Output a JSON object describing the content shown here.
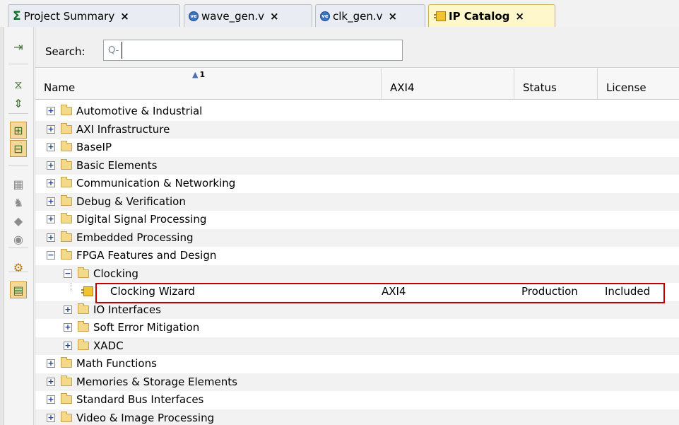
{
  "tabs": [
    {
      "label": "Project Summary",
      "icon": "sigma-icon",
      "glyph": "Σ"
    },
    {
      "label": "wave_gen.v",
      "icon": "verilog-file-icon",
      "glyph": "ve"
    },
    {
      "label": "clk_gen.v",
      "icon": "verilog-file-icon",
      "glyph": "ve"
    },
    {
      "label": "IP Catalog",
      "icon": "ip-icon",
      "active": true
    }
  ],
  "tab_close_glyph": "×",
  "search": {
    "label": "Search:",
    "value": "",
    "glyph": "Q-"
  },
  "columns": {
    "name": "Name",
    "axi4": "AXI4",
    "status": "Status",
    "license": "License",
    "sort_rank": "1",
    "sort_glyph": "▲"
  },
  "tree": [
    {
      "label": "Automotive & Industrial",
      "level": 0,
      "expander": "+"
    },
    {
      "label": "AXI Infrastructure",
      "level": 0,
      "expander": "+"
    },
    {
      "label": "BaseIP",
      "level": 0,
      "expander": "+"
    },
    {
      "label": "Basic Elements",
      "level": 0,
      "expander": "+"
    },
    {
      "label": "Communication & Networking",
      "level": 0,
      "expander": "+"
    },
    {
      "label": "Debug & Verification",
      "level": 0,
      "expander": "+"
    },
    {
      "label": "Digital Signal Processing",
      "level": 0,
      "expander": "+"
    },
    {
      "label": "Embedded Processing",
      "level": 0,
      "expander": "+"
    },
    {
      "label": "FPGA Features and Design",
      "level": 0,
      "expander": "−"
    },
    {
      "label": "Clocking",
      "level": 1,
      "expander": "−"
    },
    {
      "label": "Clocking Wizard",
      "level": 2,
      "leaf": true,
      "axi4": "AXI4",
      "status": "Production",
      "license": "Included"
    },
    {
      "label": "IO Interfaces",
      "level": 1,
      "expander": "+"
    },
    {
      "label": "Soft Error Mitigation",
      "level": 1,
      "expander": "+"
    },
    {
      "label": "XADC",
      "level": 1,
      "expander": "+"
    },
    {
      "label": "Math Functions",
      "level": 0,
      "expander": "+"
    },
    {
      "label": "Memories & Storage Elements",
      "level": 0,
      "expander": "+"
    },
    {
      "label": "Standard Bus Interfaces",
      "level": 0,
      "expander": "+"
    },
    {
      "label": "Video & Image Processing",
      "level": 0,
      "expander": "+"
    }
  ],
  "leftbar": [
    {
      "icon": "collapse-panel-icon",
      "glyph": "⇥"
    },
    {
      "icon": "collapse-all-icon",
      "glyph": "⧖"
    },
    {
      "icon": "expand-all-icon",
      "glyph": "⇕"
    },
    {
      "icon": "group-by-category-icon",
      "glyph": "⊞",
      "on": true
    },
    {
      "icon": "hierarchy-view-icon",
      "glyph": "⊟",
      "on": true
    },
    {
      "icon": "chip-icon",
      "glyph": "▦"
    },
    {
      "icon": "filter-icon",
      "glyph": "♞"
    },
    {
      "icon": "diamond-icon",
      "glyph": "◆"
    },
    {
      "icon": "repository-icon",
      "glyph": "◉"
    },
    {
      "icon": "settings-icon",
      "glyph": "⚙"
    },
    {
      "icon": "properties-icon",
      "glyph": "▤",
      "on": true
    }
  ]
}
